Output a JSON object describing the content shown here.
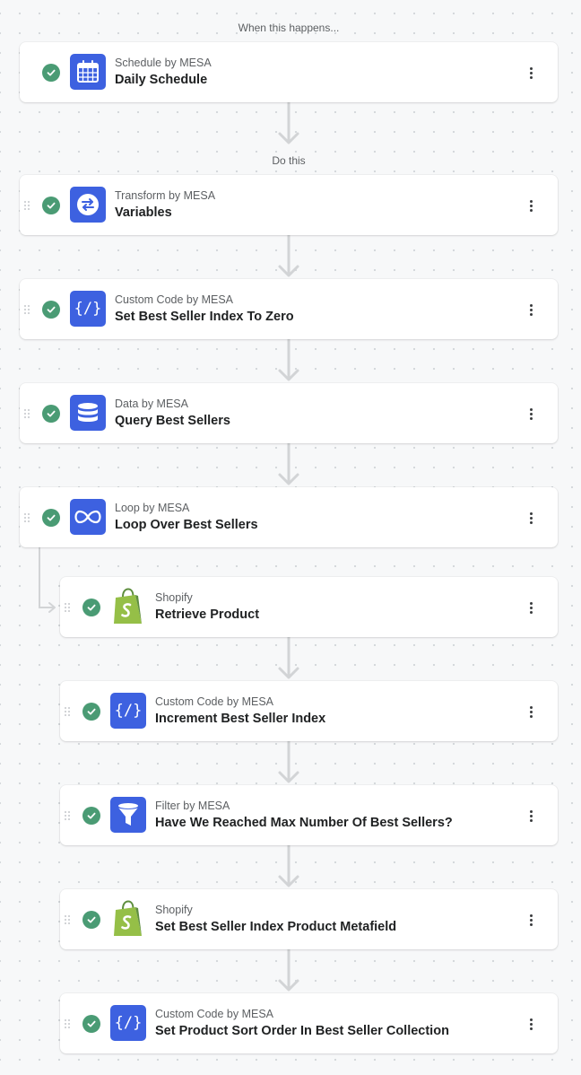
{
  "sections": {
    "trigger_label": "When this happens...",
    "action_label": "Do this"
  },
  "trigger": {
    "app": "Schedule by MESA",
    "title": "Daily Schedule",
    "icon": "calendar-icon",
    "status": "complete"
  },
  "steps": [
    {
      "app": "Transform by MESA",
      "title": "Variables",
      "icon": "transform-arrows-icon",
      "status": "complete"
    },
    {
      "app": "Custom Code by MESA",
      "title": "Set Best Seller Index To Zero",
      "icon": "code-icon",
      "status": "complete"
    },
    {
      "app": "Data by MESA",
      "title": "Query Best Sellers",
      "icon": "database-icon",
      "status": "complete"
    },
    {
      "app": "Loop by MESA",
      "title": "Loop Over Best Sellers",
      "icon": "loop-icon",
      "status": "complete"
    },
    {
      "app": "Shopify",
      "title": "Retrieve Product",
      "icon": "shopify-bag-icon",
      "status": "complete"
    },
    {
      "app": "Custom Code by MESA",
      "title": "Increment Best Seller Index",
      "icon": "code-icon",
      "status": "complete"
    },
    {
      "app": "Filter by MESA",
      "title": "Have We Reached Max Number Of Best Sellers?",
      "icon": "filter-funnel-icon",
      "status": "complete"
    },
    {
      "app": "Shopify",
      "title": "Set Best Seller Index Product Metafield",
      "icon": "shopify-bag-icon",
      "status": "complete"
    },
    {
      "app": "Custom Code by MESA",
      "title": "Set Product Sort Order In Best Seller Collection",
      "icon": "code-icon",
      "status": "complete"
    }
  ],
  "colors": {
    "mesa_icon_bg": "#3d61e0",
    "check_green": "#4a9b74",
    "connector": "#d2d4d6",
    "shopify_green": "#95bf47",
    "shopify_dark": "#5e8e3e"
  }
}
